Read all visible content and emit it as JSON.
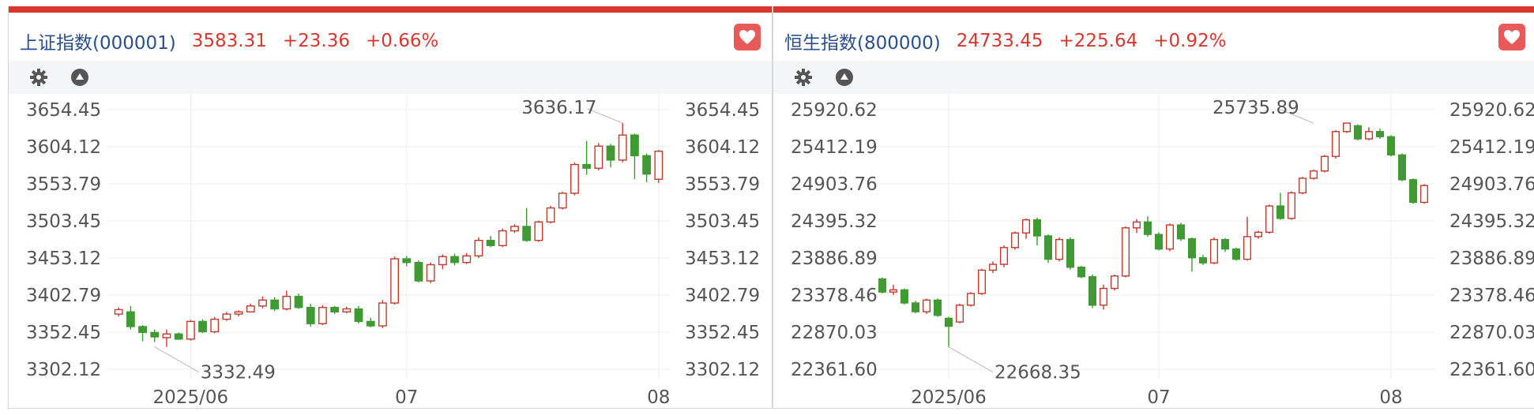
{
  "charts": [
    {
      "name": "上证指数(000001)",
      "price": "3583.31",
      "change": "+23.36",
      "pct": "+0.66%",
      "icons": [
        "heart-icon",
        "gear-icon",
        "triangle-up-icon"
      ]
    },
    {
      "name": "恒生指数(800000)",
      "price": "24733.45",
      "change": "+225.64",
      "pct": "+0.92%",
      "icons": [
        "heart-icon",
        "gear-icon",
        "triangle-up-icon"
      ]
    }
  ],
  "colors": {
    "up": "#c23a2c",
    "down": "#3f9a33",
    "accent": "#d9362d",
    "title": "#2a4f8f"
  },
  "chart_data": [
    {
      "type": "candlestick",
      "y_ticks": [
        "3654.45",
        "3604.12",
        "3553.79",
        "3503.45",
        "3453.12",
        "3402.79",
        "3352.45",
        "3302.12"
      ],
      "x_labels": [
        "2025/06",
        "07",
        "08"
      ],
      "x_label_index": [
        6,
        24,
        45
      ],
      "ylim": [
        3302.12,
        3654.45
      ],
      "grid": true,
      "annotations": [
        {
          "text": "3636.17",
          "index": 42,
          "value": 3636.17
        },
        {
          "text": "3332.49",
          "index": 3,
          "value": 3332.49
        }
      ],
      "candles": [
        [
          3377,
          3383,
          3374,
          3386
        ],
        [
          3380,
          3360,
          3356,
          3388
        ],
        [
          3360,
          3352,
          3340,
          3362
        ],
        [
          3352,
          3346,
          3339,
          3356
        ],
        [
          3345,
          3350,
          3332.49,
          3356
        ],
        [
          3350,
          3343,
          3342,
          3352
        ],
        [
          3343,
          3367,
          3341,
          3369
        ],
        [
          3367,
          3353,
          3351,
          3370
        ],
        [
          3353,
          3370,
          3351,
          3373
        ],
        [
          3370,
          3377,
          3368,
          3380
        ],
        [
          3377,
          3380,
          3374,
          3382
        ],
        [
          3380,
          3388,
          3379,
          3391
        ],
        [
          3388,
          3396,
          3385,
          3401
        ],
        [
          3396,
          3384,
          3381,
          3400
        ],
        [
          3384,
          3401,
          3382,
          3409
        ],
        [
          3401,
          3386,
          3384,
          3405
        ],
        [
          3386,
          3364,
          3360,
          3391
        ],
        [
          3364,
          3386,
          3362,
          3389
        ],
        [
          3386,
          3380,
          3377,
          3388
        ],
        [
          3380,
          3384,
          3378,
          3387
        ],
        [
          3384,
          3367,
          3364,
          3388
        ],
        [
          3367,
          3361,
          3359,
          3372
        ],
        [
          3361,
          3392,
          3358,
          3396
        ],
        [
          3392,
          3452,
          3390,
          3455
        ],
        [
          3452,
          3447,
          3442,
          3456
        ],
        [
          3447,
          3422,
          3420,
          3450
        ],
        [
          3422,
          3444,
          3419,
          3447
        ],
        [
          3444,
          3455,
          3438,
          3458
        ],
        [
          3455,
          3447,
          3443,
          3459
        ],
        [
          3447,
          3456,
          3445,
          3460
        ],
        [
          3456,
          3477,
          3453,
          3481
        ],
        [
          3477,
          3470,
          3468,
          3483
        ],
        [
          3470,
          3490,
          3468,
          3493
        ],
        [
          3490,
          3496,
          3487,
          3499
        ],
        [
          3496,
          3477,
          3475,
          3521
        ],
        [
          3477,
          3502,
          3475,
          3504
        ],
        [
          3502,
          3521,
          3500,
          3524
        ],
        [
          3521,
          3541,
          3519,
          3543
        ],
        [
          3541,
          3580,
          3538,
          3583
        ],
        [
          3580,
          3575,
          3566,
          3612
        ],
        [
          3575,
          3605,
          3572,
          3609
        ],
        [
          3605,
          3586,
          3576,
          3608
        ],
        [
          3586,
          3620,
          3583,
          3636.17
        ],
        [
          3620,
          3592,
          3560,
          3622
        ],
        [
          3592,
          3567,
          3556,
          3595
        ],
        [
          3560,
          3598,
          3555,
          3600
        ]
      ]
    },
    {
      "type": "candlestick",
      "y_ticks": [
        "25920.62",
        "25412.19",
        "24903.76",
        "24395.32",
        "23886.89",
        "23378.46",
        "22870.03",
        "22361.60"
      ],
      "x_labels": [
        "2025/06",
        "07",
        "08"
      ],
      "x_label_index": [
        6,
        25,
        46
      ],
      "ylim": [
        22361.6,
        25920.62
      ],
      "grid": true,
      "annotations": [
        {
          "text": "25735.89",
          "index": 39,
          "value": 25735.89
        },
        {
          "text": "22668.35",
          "index": 6,
          "value": 22668.35
        }
      ],
      "candles": [
        [
          23600,
          23420,
          23400,
          23620
        ],
        [
          23420,
          23450,
          23380,
          23520
        ],
        [
          23450,
          23270,
          23250,
          23470
        ],
        [
          23270,
          23150,
          23130,
          23300
        ],
        [
          23150,
          23310,
          23120,
          23330
        ],
        [
          23310,
          23100,
          23080,
          23330
        ],
        [
          23060,
          22950,
          22668.35,
          23080
        ],
        [
          23010,
          23240,
          22990,
          23260
        ],
        [
          23240,
          23400,
          23220,
          23420
        ],
        [
          23400,
          23720,
          23380,
          23740
        ],
        [
          23720,
          23800,
          23680,
          23840
        ],
        [
          23800,
          24030,
          23760,
          24060
        ],
        [
          24030,
          24230,
          24000,
          24250
        ],
        [
          24230,
          24410,
          24150,
          24430
        ],
        [
          24410,
          24190,
          24060,
          24440
        ],
        [
          24190,
          23870,
          23820,
          24210
        ],
        [
          23870,
          24140,
          23840,
          24170
        ],
        [
          24140,
          23760,
          23730,
          24170
        ],
        [
          23760,
          23630,
          23610,
          23780
        ],
        [
          23630,
          23240,
          23200,
          23660
        ],
        [
          23240,
          23470,
          23180,
          23520
        ],
        [
          23470,
          23640,
          23440,
          23660
        ],
        [
          23640,
          24300,
          23620,
          24320
        ],
        [
          24300,
          24380,
          24230,
          24420
        ],
        [
          24380,
          24210,
          24180,
          24460
        ],
        [
          24210,
          24010,
          23990,
          24240
        ],
        [
          24010,
          24340,
          23980,
          24360
        ],
        [
          24340,
          24150,
          24120,
          24370
        ],
        [
          24150,
          23890,
          23700,
          24170
        ],
        [
          23890,
          23820,
          23790,
          23930
        ],
        [
          23820,
          24140,
          23800,
          24170
        ],
        [
          24140,
          24010,
          23970,
          24160
        ],
        [
          24010,
          23870,
          23850,
          24030
        ],
        [
          23870,
          24180,
          23850,
          24450
        ],
        [
          24180,
          24240,
          24150,
          24260
        ],
        [
          24240,
          24600,
          24220,
          24620
        ],
        [
          24600,
          24430,
          24410,
          24780
        ],
        [
          24430,
          24780,
          24410,
          24800
        ],
        [
          24780,
          24980,
          24760,
          25000
        ],
        [
          24980,
          25080,
          24960,
          25100
        ],
        [
          25080,
          25280,
          25060,
          25300
        ],
        [
          25280,
          25620,
          25250,
          25640
        ],
        [
          25620,
          25735.89,
          25600,
          25735.89
        ],
        [
          25700,
          25520,
          25500,
          25720
        ],
        [
          25520,
          25620,
          25500,
          25680
        ],
        [
          25620,
          25550,
          25520,
          25660
        ],
        [
          25550,
          25300,
          25280,
          25570
        ],
        [
          25300,
          24960,
          24940,
          25320
        ],
        [
          24960,
          24650,
          24630,
          24980
        ],
        [
          24650,
          24880,
          24630,
          24900
        ]
      ]
    }
  ]
}
